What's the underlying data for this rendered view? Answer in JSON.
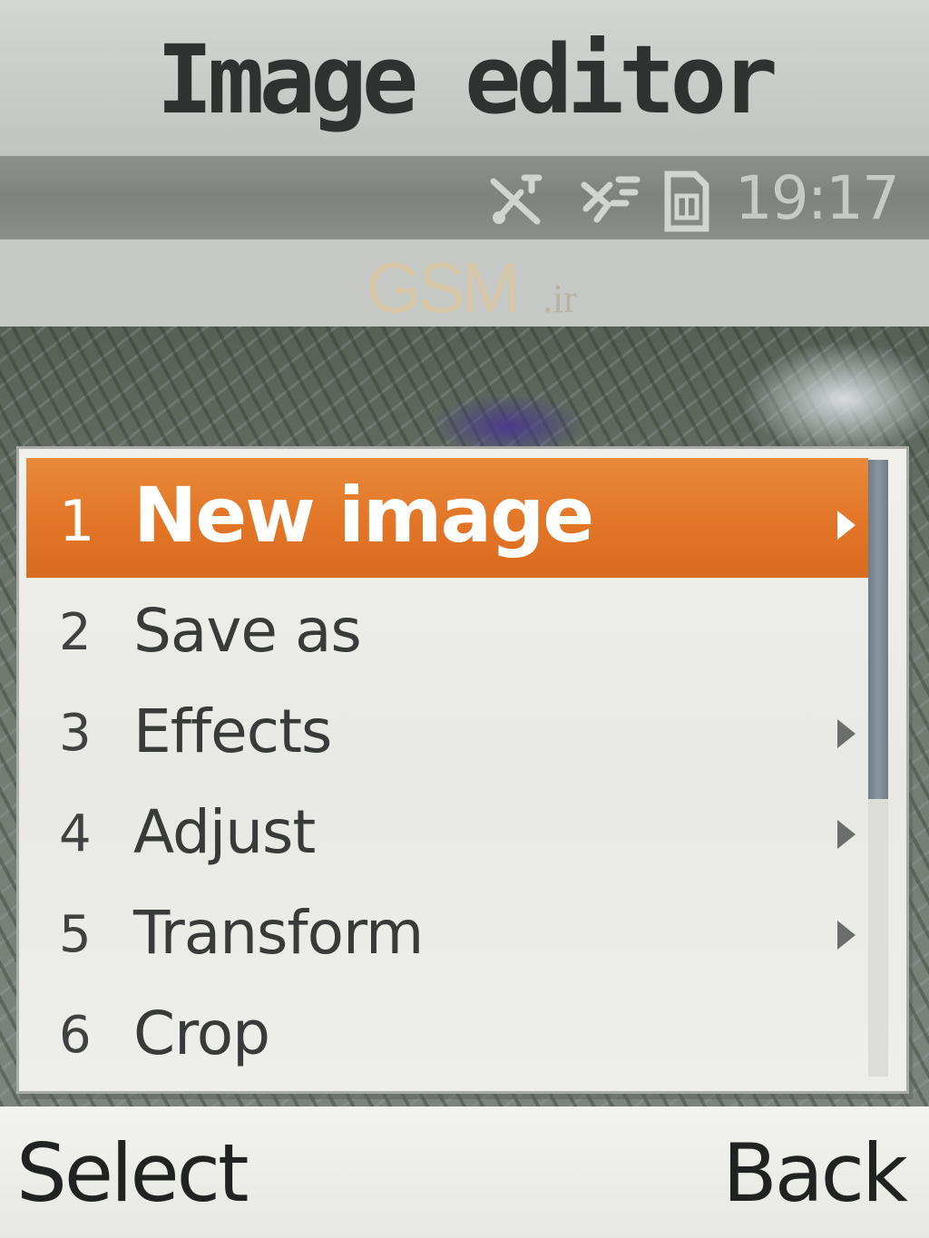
{
  "title_bar": {
    "title": "Image editor"
  },
  "status_bar": {
    "icons": [
      "no-signal-icon",
      "bluetooth-icon",
      "sim-card-icon"
    ],
    "time": "19:17"
  },
  "watermark": {
    "brand": "GSM",
    "suffix": ".ir"
  },
  "menu": {
    "items": [
      {
        "number": "1",
        "label": "New image",
        "has_submenu": true,
        "selected": true
      },
      {
        "number": "2",
        "label": "Save as",
        "has_submenu": false,
        "selected": false
      },
      {
        "number": "3",
        "label": "Effects",
        "has_submenu": true,
        "selected": false
      },
      {
        "number": "4",
        "label": "Adjust",
        "has_submenu": true,
        "selected": false
      },
      {
        "number": "5",
        "label": "Transform",
        "has_submenu": true,
        "selected": false
      },
      {
        "number": "6",
        "label": "Crop",
        "has_submenu": false,
        "selected": false
      }
    ],
    "scroll_fraction_visible": 0.55
  },
  "softkeys": {
    "left": "Select",
    "right": "Back"
  },
  "colors": {
    "highlight": "#e27526",
    "scrollbar": "#7a8793"
  }
}
